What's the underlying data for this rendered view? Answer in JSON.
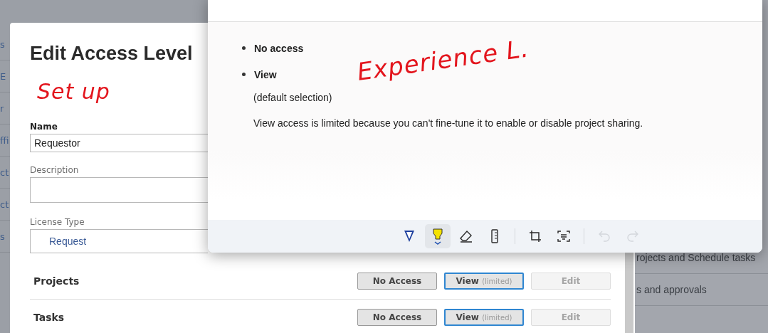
{
  "background_page": {
    "left_fragments": [
      "s",
      "E",
      "r",
      "ffi",
      "ct",
      "ct",
      "s"
    ],
    "right_rows": [
      "rojects and Schedule tasks",
      "s and approvals"
    ]
  },
  "dialog": {
    "title": "Edit Access Level",
    "ink_note": "Set up",
    "fields": [
      {
        "label": "Name",
        "value": "Requestor",
        "kind": "input"
      },
      {
        "label": "Description",
        "kind": "textarea"
      },
      {
        "label": "License Type",
        "value": "Request",
        "kind": "select"
      }
    ],
    "access_rows": [
      {
        "name": "Projects",
        "options": [
          {
            "label": "No Access",
            "selected": false,
            "disabled": false
          },
          {
            "label": "View",
            "note": "(limited)",
            "selected": true,
            "disabled": false
          },
          {
            "label": "Edit",
            "selected": false,
            "disabled": true
          }
        ]
      },
      {
        "name": "Tasks",
        "options": [
          {
            "label": "No Access",
            "selected": false,
            "disabled": false
          },
          {
            "label": "View",
            "note": "(limited)",
            "selected": true,
            "disabled": false
          },
          {
            "label": "Edit",
            "selected": false,
            "disabled": true
          }
        ]
      }
    ]
  },
  "snip_window": {
    "ink_note": "Experience L.",
    "bullets": [
      "No access",
      "View"
    ],
    "paragraphs": [
      "(default selection)",
      "View access is limited because you can't fine-tune it to enable or disable project sharing."
    ],
    "toolbar": [
      {
        "kind": "pen",
        "selected": false,
        "disabled": false
      },
      {
        "kind": "highlighter",
        "selected": true,
        "disabled": false
      },
      {
        "kind": "eraser",
        "selected": false,
        "disabled": false
      },
      {
        "kind": "ruler",
        "selected": false,
        "disabled": false
      },
      {
        "kind": "separator"
      },
      {
        "kind": "crop",
        "selected": false,
        "disabled": false
      },
      {
        "kind": "text-actions",
        "selected": false,
        "disabled": false
      },
      {
        "kind": "separator"
      },
      {
        "kind": "undo",
        "selected": false,
        "disabled": true
      },
      {
        "kind": "redo",
        "selected": false,
        "disabled": true
      }
    ]
  }
}
